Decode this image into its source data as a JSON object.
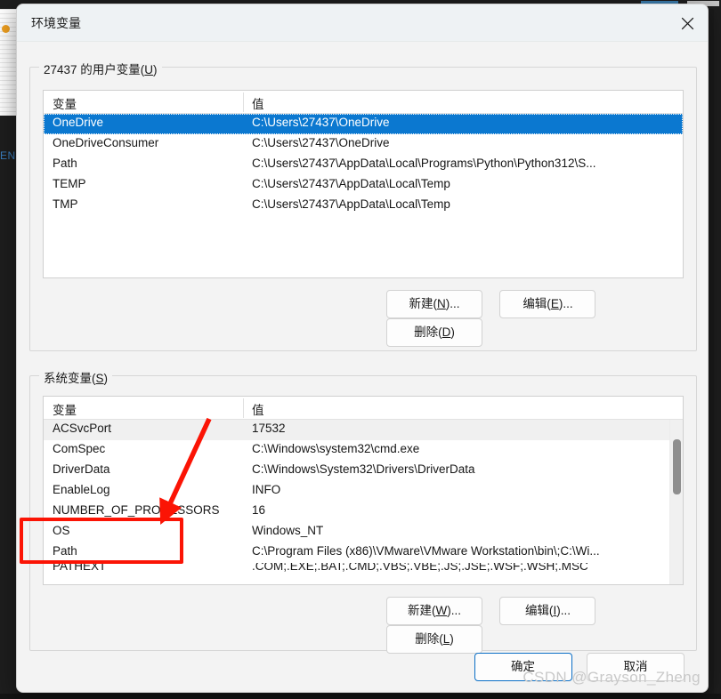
{
  "dialog": {
    "title": "环境变量",
    "close_label": "关闭"
  },
  "user_section": {
    "legend_prefix": "27437 的用户变量(",
    "legend_accel": "U",
    "legend_suffix": ")",
    "columns": [
      "变量",
      "值"
    ],
    "rows": [
      {
        "name": "OneDrive",
        "value": "C:\\Users\\27437\\OneDrive",
        "selected": true
      },
      {
        "name": "OneDriveConsumer",
        "value": "C:\\Users\\27437\\OneDrive",
        "selected": false
      },
      {
        "name": "Path",
        "value": "C:\\Users\\27437\\AppData\\Local\\Programs\\Python\\Python312\\S...",
        "selected": false
      },
      {
        "name": "TEMP",
        "value": "C:\\Users\\27437\\AppData\\Local\\Temp",
        "selected": false
      },
      {
        "name": "TMP",
        "value": "C:\\Users\\27437\\AppData\\Local\\Temp",
        "selected": false
      }
    ],
    "buttons": [
      {
        "prefix": "新建(",
        "accel": "N",
        "suffix": ")..."
      },
      {
        "prefix": "编辑(",
        "accel": "E",
        "suffix": ")..."
      },
      {
        "prefix": "删除(",
        "accel": "D",
        "suffix": ")"
      }
    ]
  },
  "system_section": {
    "legend_prefix": "系统变量(",
    "legend_accel": "S",
    "legend_suffix": ")",
    "columns": [
      "变量",
      "值"
    ],
    "rows": [
      {
        "name": "ACSvcPort",
        "value": "17532",
        "alt": true
      },
      {
        "name": "ComSpec",
        "value": "C:\\Windows\\system32\\cmd.exe",
        "alt": false
      },
      {
        "name": "DriverData",
        "value": "C:\\Windows\\System32\\Drivers\\DriverData",
        "alt": false
      },
      {
        "name": "EnableLog",
        "value": "INFO",
        "alt": false
      },
      {
        "name": "NUMBER_OF_PROCESSORS",
        "value": "16",
        "alt": false
      },
      {
        "name": "OS",
        "value": "Windows_NT",
        "alt": false
      },
      {
        "name": "Path",
        "value": "C:\\Program Files (x86)\\VMware\\VMware Workstation\\bin\\;C:\\Wi...",
        "alt": false
      },
      {
        "name": "PATHEXT",
        "value": ".COM;.EXE;.BAT;.CMD;.VBS;.VBE;.JS;.JSE;.WSF;.WSH;.MSC",
        "alt": false
      }
    ],
    "buttons": [
      {
        "prefix": "新建(",
        "accel": "W",
        "suffix": ")..."
      },
      {
        "prefix": "编辑(",
        "accel": "I",
        "suffix": ")..."
      },
      {
        "prefix": "删除(",
        "accel": "L",
        "suffix": ")"
      }
    ]
  },
  "footer": {
    "ok_label": "确定",
    "cancel_label": "取消"
  },
  "annotations": {
    "highlight_color": "#fb1405",
    "arrow_color": "#fb1405"
  },
  "watermark": "CSDN @Grayson_Zheng",
  "background": {
    "left_label": "EN"
  }
}
